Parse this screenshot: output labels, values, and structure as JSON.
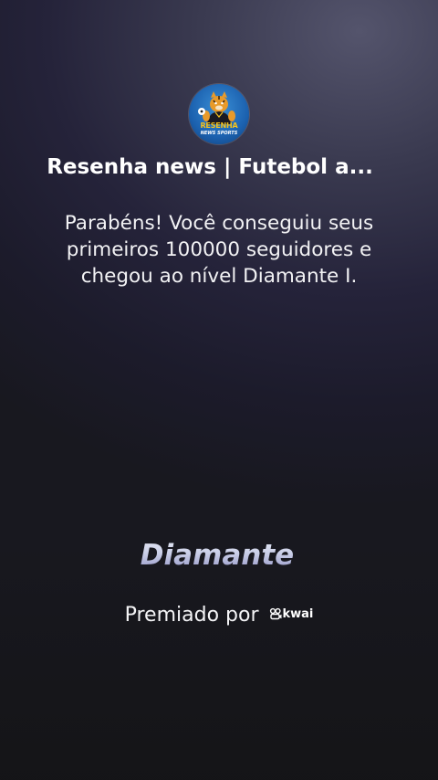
{
  "account": {
    "avatar_text_line1": "RESENHA",
    "avatar_text_line2": "NEWS SPORTS",
    "name": "Resenha news | Futebol a..."
  },
  "message": "Parabéns! Você conseguiu seus primeiros 100000 seguidores e chegou ao nível Diamante I.",
  "level_name": "Diamante",
  "awarded": {
    "label": "Premiado por",
    "brand": "kwai",
    "brand_icon": "kwai-logo-icon"
  },
  "colors": {
    "background_top": "#54546c",
    "background_mid": "#25233a",
    "background_bottom": "#18181f",
    "level_gradient_top": "#e4e8f6",
    "level_gradient_bottom": "#8e8fc4",
    "avatar_blue": "#1c62b0",
    "avatar_gold": "#f4c21d"
  }
}
